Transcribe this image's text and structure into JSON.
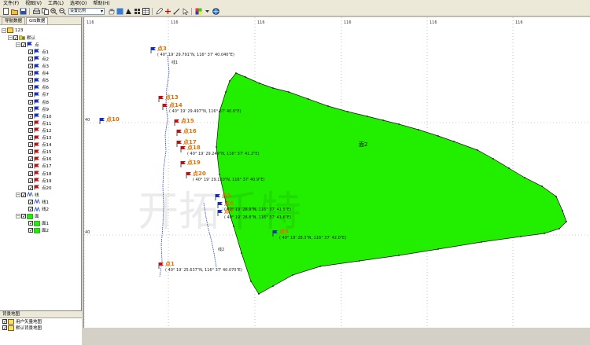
{
  "menu": [
    "文件(F)",
    "视图(V)",
    "工具(L)",
    "选项(O)",
    "帮助(H)"
  ],
  "toolbar": {
    "scale_value": "设置比例"
  },
  "left_panel": {
    "tabs": [
      "导航数据",
      "GIS数据"
    ],
    "root_label": "123",
    "default_label": "默认",
    "points_group": "点",
    "points": [
      "点1",
      "点2",
      "点3",
      "点4",
      "点5",
      "点6",
      "点7",
      "点8",
      "点9",
      "点10",
      "点11",
      "点12",
      "点13",
      "点14",
      "点15",
      "点16",
      "点17",
      "点18",
      "点19",
      "点20"
    ],
    "point_colors": [
      "#1030c8",
      "#1030c8",
      "#1030c8",
      "#1030c8",
      "#1030c8",
      "#1030c8",
      "#1030c8",
      "#1030c8",
      "#1030c8",
      "#1030c8",
      "#c01010",
      "#c01010",
      "#c01010",
      "#c01010",
      "#c01010",
      "#c01010",
      "#c01010",
      "#c01010",
      "#c01010",
      "#c01010"
    ],
    "lines_group": "线",
    "lines": [
      "线1",
      "线2"
    ],
    "areas_group": "面",
    "areas": [
      "面1",
      "面2"
    ],
    "bg_panel_title": "背景地图",
    "bg_items": [
      "用户矢量地图",
      "默认背景地图"
    ]
  },
  "map": {
    "ticks_top": [
      "116",
      "116",
      "116",
      "116",
      "116",
      "116"
    ],
    "ticks_left": [
      "40",
      "40"
    ],
    "area_label": "面2",
    "area_color": "#22ee00",
    "line_color": "#2040c0",
    "label_color": "#e07000",
    "points": [
      {
        "label": "点3",
        "coord": "( 40° 19' 29.791\"N, 116° 37' 40.040\"E)"
      },
      {
        "label": "点13",
        "coord": ""
      },
      {
        "label": "点14",
        "coord": "( 40° 19' 29.497\"N, 116° 37' 40.6\"E)"
      },
      {
        "label": "点10",
        "coord": ""
      },
      {
        "label": "点15",
        "coord": ""
      },
      {
        "label": "点16",
        "coord": ""
      },
      {
        "label": "点17",
        "coord": ""
      },
      {
        "label": "点18",
        "coord": "( 40° 19' 29.249\"N, 116° 37' 41.2\"E)"
      },
      {
        "label": "点19",
        "coord": ""
      },
      {
        "label": "点20",
        "coord": "( 40° 19' 29.110\"N, 116° 37' 40.9\"E)"
      },
      {
        "label": "点5",
        "coord": ""
      },
      {
        "label": "点6",
        "coord": "( 40° 19' 28.9\"N, 116° 37' 41.5\"E)"
      },
      {
        "label": "点7",
        "coord": "( 40° 19' 28.8\"N, 116° 37' 41.6\"E)"
      },
      {
        "label": "点1",
        "coord": "( 40° 19' 25.637\"N, 116° 37' 40.070\"E)"
      },
      {
        "label": "点8",
        "coord": "( 40° 19' 28.3\"N, 116° 37' 42.0\"E)"
      }
    ],
    "line_labels": [
      "线1",
      "线2"
    ],
    "watermark": "开拓千特"
  }
}
